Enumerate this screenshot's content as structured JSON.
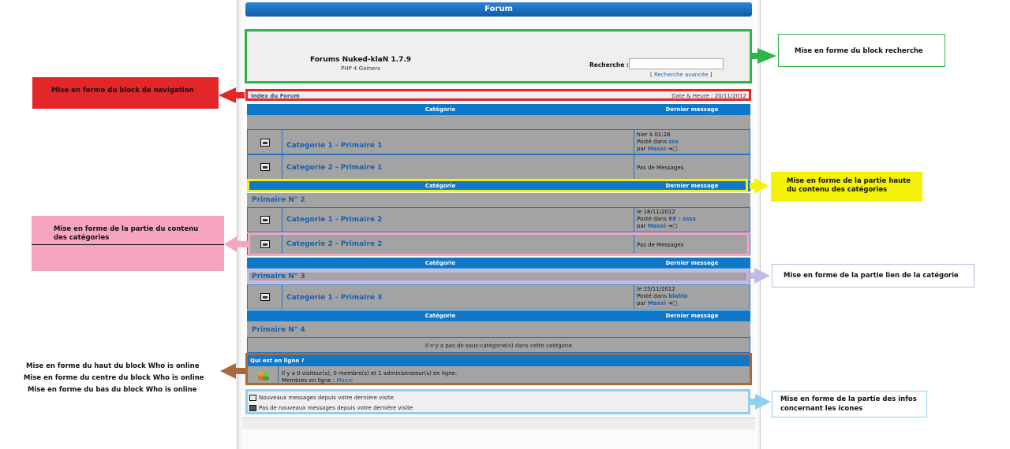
{
  "forum": {
    "title": "Forum",
    "site_title": "Forums Nuked-klaN 1.7.9",
    "site_subtitle": "PHP 4 Gamers",
    "search_label": "Recherche :",
    "search_value": "",
    "advanced_search": "Recherche avancée",
    "nav_index": "Index du Forum",
    "nav_date": "Date & Heure : 20/11/2012",
    "col_category": "Catégorie",
    "col_last": "Dernier message"
  },
  "rows": [
    {
      "name": "Categorie 1  - Primaire 1",
      "last": [
        "hier à 01:28",
        "Posté dans ",
        "sss",
        "par ",
        "Maxxi"
      ]
    },
    {
      "name": "Categorie 2 - Primaire 1",
      "last_text": "Pas de Messages"
    },
    {
      "section": "Primaire N° 2"
    },
    {
      "name": "Categorie 1 - Primaire 2",
      "last": [
        "le 18/11/2012",
        "Posté dans ",
        "RE : ssss",
        "par ",
        "Maxxi"
      ]
    },
    {
      "name": "Categorie 2 - Primaire 2",
      "last_text": "Pas de Messages"
    },
    {
      "section": "Primaire N° 3"
    },
    {
      "name": "Categorie 1 - Primaire 3",
      "last": [
        "le 15/11/2012",
        "Posté dans ",
        "blabla",
        "par ",
        "Maxxi"
      ]
    },
    {
      "section": "Primaire N° 4"
    },
    {
      "empty": "Il n'y a pas de sous-catégorie(s) dans cette catégorie"
    }
  ],
  "who": {
    "title": "Qui est en ligne ?",
    "line1": "Il y a 0 visiteur(s), 0 membre(s) et 1 administrateur(s) en ligne.",
    "line2_prefix": "Membres en ligne : ",
    "line2_user": "Maxxi"
  },
  "legend": {
    "new": "Nouveaux messages depuis votre dernière visite",
    "no_new": "Pas de nouveaux messages depuis votre dernière visite"
  },
  "callouts": {
    "search": "Mise en forme du block recherche",
    "nav": "Mise en forme du block de navigation",
    "cat_top_1": "Mise en forme de la partie  haute",
    "cat_top_2": "du contenu des catégories",
    "cat_content_1": "Mise en forme de la partie  du contenu",
    "cat_content_2": "des catégories",
    "cat_link": "Mise en forme de la partie lien de la catégorie",
    "who_1": "Mise en forme du haut du block Who is online",
    "who_2": "Mise en forme du centre du block Who is online",
    "who_3": "Mise en forme du bas du block Who is online",
    "icons_1": "Mise en forme de la partie des infos",
    "icons_2": "concernant les icones"
  },
  "colors": {
    "green": "#2fb34a",
    "red": "#e3262a",
    "yellow": "#f5f10a",
    "pink": "#f6a5c0",
    "lavender": "#c4b8e6",
    "brown": "#a86a3c",
    "lightblue": "#8fd0ea",
    "header_blue": "#0f78c8"
  }
}
